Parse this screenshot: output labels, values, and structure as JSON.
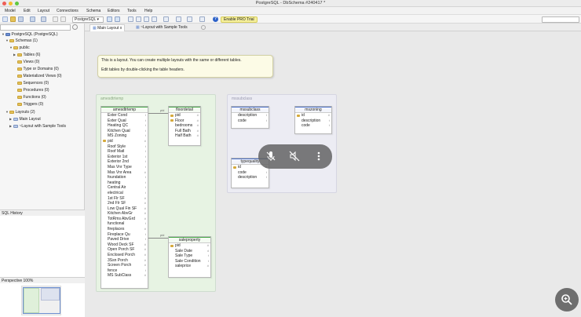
{
  "window": {
    "title": "PostgreSQL - DbSchema #240417 *"
  },
  "menu": [
    "Model",
    "Edit",
    "Layout",
    "Connections",
    "Schema",
    "Editors",
    "Tools",
    "Help"
  ],
  "toolbar": {
    "db_select": "PostgreSQL",
    "pro_trial": "Enable PRO Trial",
    "help": "?"
  },
  "tree": {
    "root": "PostgreSQL (PostgreSQL)",
    "schemas": "Schemas (1)",
    "public": "public",
    "tables": "Tables (6)",
    "views": "Views (0)",
    "types": "Type or Domains (0)",
    "matviews": "Materialized Views (0)",
    "sequences": "Sequences (0)",
    "procedures": "Procedures (0)",
    "functions": "Functions (0)",
    "triggers": "Triggers (0)",
    "layouts": "Layouts (2)",
    "main_layout": "Main Layout",
    "sample_layout": "~Layout with Sample Tools"
  },
  "panels": {
    "sql_history": "SQL History",
    "perspective": "Perspective 100%"
  },
  "tabs": [
    {
      "label": "Main Layout"
    },
    {
      "label": "~Layout with Sample Tools"
    }
  ],
  "tab_close": "x",
  "note": {
    "line1": "This is a layout. You can create multiple layouts with the same or different tables.",
    "line2": "Edit tables by double-clicking the table headers."
  },
  "areas": {
    "a1": "amesdtrtemp",
    "a2": "mssubclass"
  },
  "tables": {
    "amesdtrtemp": {
      "name": "amesdtrtemp",
      "rows": [
        [
          "Exter Cond",
          "t"
        ],
        [
          "Exter Qual",
          "t"
        ],
        [
          "Heating QC",
          "t"
        ],
        [
          "Kitchen Qual",
          "t"
        ],
        [
          "MS Zoning",
          "t"
        ],
        [
          "pid",
          "#"
        ],
        [
          "Roof Style",
          "t"
        ],
        [
          "Roof Matl",
          "t"
        ],
        [
          "Exterior 1st",
          "t"
        ],
        [
          "Exterior 2nd",
          "t"
        ],
        [
          "Mas Vnr Type",
          "t"
        ],
        [
          "Mas Vnr Area",
          "#"
        ],
        [
          "foundation",
          "t"
        ],
        [
          "heating",
          "t"
        ],
        [
          "Central Air",
          "t"
        ],
        [
          "electrical",
          "t"
        ],
        [
          "1st Flr SF",
          "#"
        ],
        [
          "2nd Flr SF",
          "#"
        ],
        [
          "Low Qual Fin SF",
          "#"
        ],
        [
          "Kitchen AbvGr",
          "#"
        ],
        [
          "TotRms AbvGrd",
          "#"
        ],
        [
          "functional",
          "t"
        ],
        [
          "fireplaces",
          "#"
        ],
        [
          "Fireplace Qu",
          "t"
        ],
        [
          "Paved Drive",
          "t"
        ],
        [
          "Wood Deck SF",
          "#"
        ],
        [
          "Open Porch SF",
          "#"
        ],
        [
          "Enclosed Porch",
          "#"
        ],
        [
          "3Ssn Porch",
          "#"
        ],
        [
          "Screen Porch",
          "#"
        ],
        [
          "fence",
          "t"
        ],
        [
          "MS SubClass",
          "#"
        ]
      ]
    },
    "floordetail": {
      "name": "floordetail",
      "rows": [
        [
          "pid",
          "#"
        ],
        [
          "Floor",
          "#"
        ],
        [
          "bedrooms",
          "#"
        ],
        [
          "Full Bath",
          "#"
        ],
        [
          "Half Bath",
          "#"
        ]
      ]
    },
    "mssubclass": {
      "name": "mssubclass",
      "rows": [
        [
          "description",
          "t"
        ],
        [
          "code",
          "t"
        ]
      ]
    },
    "mszoning": {
      "name": "mszoning",
      "rows": [
        [
          "id",
          "#"
        ],
        [
          "description",
          "t"
        ],
        [
          "code",
          "t"
        ]
      ]
    },
    "typequality": {
      "name": "typequality",
      "rows": [
        [
          "id",
          "#"
        ],
        [
          "code",
          "t"
        ],
        [
          "description",
          "t"
        ]
      ]
    },
    "saleproperty": {
      "name": "saleproperty",
      "rows": [
        [
          "pid",
          "#"
        ],
        [
          "Sale Date",
          "d"
        ],
        [
          "Sale Type",
          "t"
        ],
        [
          "Sale Condition",
          "t"
        ],
        [
          "saleprice",
          "#"
        ]
      ]
    }
  },
  "connectors": {
    "fk1": "pid",
    "fk2": "pid"
  },
  "icons": {
    "overlay": [
      "mic-off-icon",
      "sound-off-icon",
      "more-vert-icon"
    ],
    "fab": "zoom-in-icon"
  }
}
